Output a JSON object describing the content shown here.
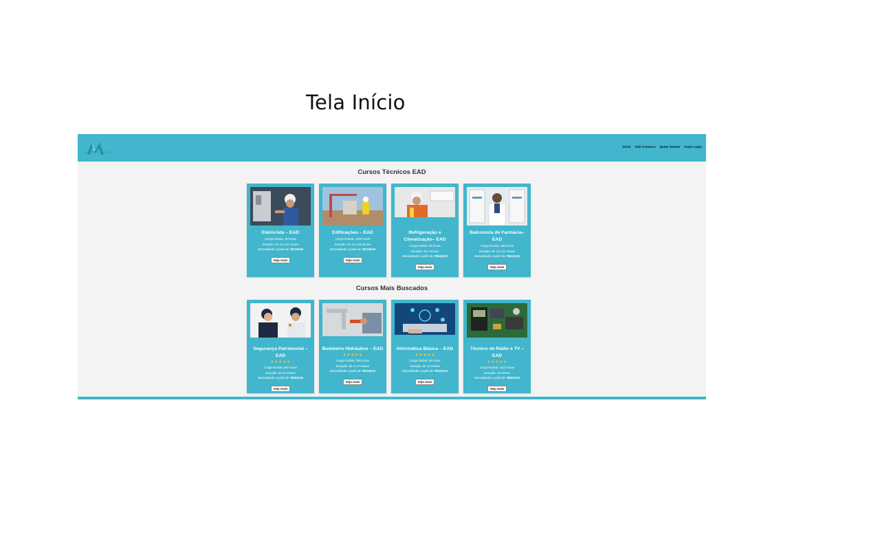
{
  "slide": {
    "title": "Tela Início"
  },
  "site": {
    "logo_text": "MARTINS CURSOS",
    "nav": [
      "Início",
      "Fale Conosco",
      "Quem Somos",
      "Fazer Login"
    ],
    "section1_title": "Cursos Técnicos EAD",
    "section2_title": "Cursos Mais Buscados",
    "button_label": "Veja mais",
    "rating": "★★★★★",
    "colors": {
      "brand": "#41b6cc",
      "page_bg": "#f3f3f3",
      "stars": "#f3c13a"
    }
  },
  "courses_tecnicos": [
    {
      "name": "Eletricista – EAD",
      "carga": "Carga horária: 40 horas",
      "duracao": "Duração: de 12 a 24 meses",
      "mensalidade_label": "Mensalidade a partir de:",
      "preco": "R$135,00",
      "image_icon": "electrician-photo"
    },
    {
      "name": "Edificações – EAD",
      "carga": "Carga horária: 1260 horas",
      "duracao": "Duração: de 12 a 18 meses",
      "mensalidade_label": "Mensalidade a partir de:",
      "preco": "R$135,00",
      "image_icon": "construction-photo"
    },
    {
      "name": "Refrigeração e Climatização– EAD",
      "carga": "Carga horária: 40 horas",
      "duracao": "Duração: de 3 meses",
      "mensalidade_label": "Mensalidade a partir de:",
      "preco": "R$165,00",
      "image_icon": "hvac-technician-photo"
    },
    {
      "name": "Balconista de Farmácia–EAD",
      "carga": "Carga horária: 180 horas",
      "duracao": "Duração: de 12 a 24 meses",
      "mensalidade_label": "Mensalidade a partir de:",
      "preco": "R$125,00",
      "image_icon": "pharmacist-photo"
    }
  ],
  "courses_buscados": [
    {
      "name": "Segurança Patrimonial – EAD",
      "carga": "Carga horária: 180 horas",
      "duracao": "Duração: de 24 meses",
      "mensalidade_label": "Mensalidade a partir de:",
      "preco": "R$200,00",
      "image_icon": "security-guard-photo"
    },
    {
      "name": "Bombeiro Hidráulico – EAD",
      "carga": "Carga horária: 180 horas",
      "duracao": "Duração: de 2 a 3 meses",
      "mensalidade_label": "Mensalidade a partir de:",
      "preco": "R$100,00",
      "image_icon": "plumber-photo"
    },
    {
      "name": "Informática Básica – EAD",
      "carga": "Carga horária: 60 horas",
      "duracao": "Duração: de 10 meses",
      "mensalidade_label": "Mensalidade a partir de:",
      "preco": "R$100,00",
      "image_icon": "laptop-photo"
    },
    {
      "name": "Técnico de Rádio e TV – EAD",
      "carga": "Carga horária: 1024 horas",
      "duracao": "Duração: 18 meses",
      "mensalidade_label": "Mensalidade a partir de:",
      "preco": "R$200,00",
      "image_icon": "electronics-board-photo"
    }
  ]
}
